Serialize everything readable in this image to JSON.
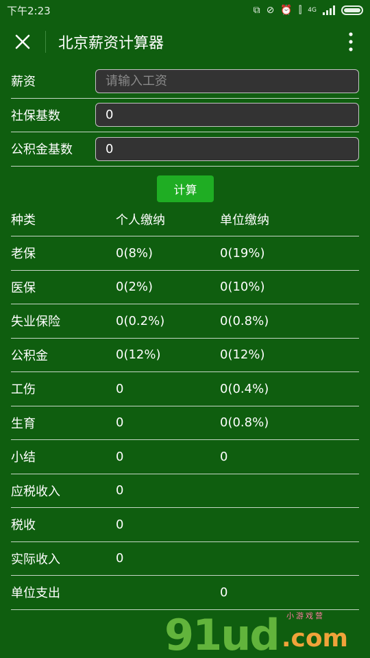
{
  "status_bar": {
    "time": "下午2:23",
    "network_label": "4G"
  },
  "title_bar": {
    "title": "北京薪资计算器"
  },
  "form": {
    "salary": {
      "label": "薪资",
      "value": "",
      "placeholder": "请输入工资"
    },
    "social_base": {
      "label": "社保基数",
      "value": "0"
    },
    "fund_base": {
      "label": "公积金基数",
      "value": "0"
    }
  },
  "button": {
    "calc_label": "计算"
  },
  "table": {
    "headers": [
      "种类",
      "个人缴纳",
      "单位缴纳"
    ],
    "rows": [
      [
        "老保",
        "0(8%)",
        "0(19%)"
      ],
      [
        "医保",
        "0(2%)",
        "0(10%)"
      ],
      [
        "失业保险",
        "0(0.2%)",
        "0(0.8%)"
      ],
      [
        "公积金",
        "0(12%)",
        "0(12%)"
      ],
      [
        "工伤",
        "0",
        "0(0.4%)"
      ],
      [
        "生育",
        "0",
        "0(0.8%)"
      ],
      [
        "小结",
        "0",
        "0"
      ],
      [
        "应税收入",
        "0",
        ""
      ],
      [
        "税收",
        "0",
        ""
      ],
      [
        "实际收入",
        "0",
        ""
      ],
      [
        "单位支出",
        "",
        "0"
      ]
    ]
  },
  "watermark": {
    "text": "91ud",
    "suffix": ".com",
    "sub": "小游戏营"
  },
  "colors": {
    "background": "#0f5e0f",
    "button": "#1fad23",
    "input_bg": "#333333"
  },
  "icons": [
    "close-icon",
    "more-vertical-icon",
    "wifi-icon",
    "battery-icon",
    "alarm-icon",
    "signal-icon"
  ]
}
